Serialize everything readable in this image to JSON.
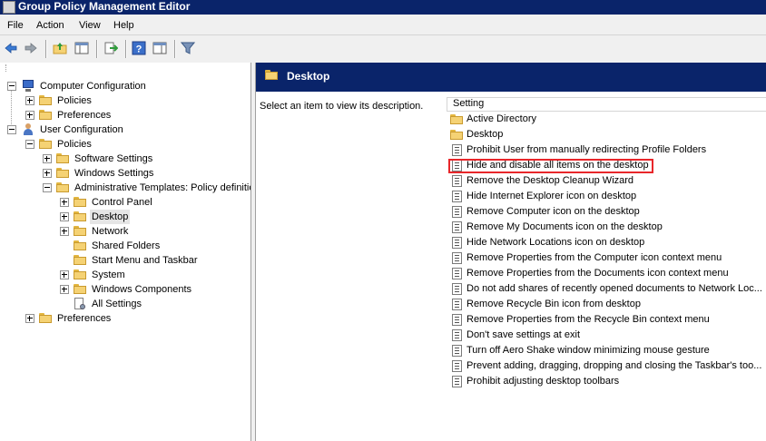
{
  "window": {
    "title": "Group Policy Management Editor"
  },
  "menu": {
    "items": [
      "File",
      "Action",
      "View",
      "Help"
    ]
  },
  "toolbar": {
    "buttons": [
      "back-icon",
      "forward-icon",
      "up-folder-icon",
      "show-hide-console-tree-icon",
      "export-list-icon",
      "help-icon",
      "properties-view-icon",
      "filter-icon"
    ]
  },
  "tree": {
    "items": [
      {
        "label": "Computer Configuration",
        "icon": "computer-icon",
        "expander": "minus"
      },
      {
        "label": "Policies",
        "icon": "folder-icon",
        "expander": "plus"
      },
      {
        "label": "Preferences",
        "icon": "folder-icon",
        "expander": "plus"
      },
      {
        "label": "User Configuration",
        "icon": "user-icon",
        "expander": "minus"
      },
      {
        "label": "Policies",
        "icon": "folder-icon",
        "expander": "minus"
      },
      {
        "label": "Software Settings",
        "icon": "folder-icon",
        "expander": "plus"
      },
      {
        "label": "Windows Settings",
        "icon": "folder-icon",
        "expander": "plus"
      },
      {
        "label": "Administrative Templates: Policy definitio",
        "icon": "folder-icon",
        "expander": "minus"
      },
      {
        "label": "Control Panel",
        "icon": "folder-icon",
        "expander": "plus"
      },
      {
        "label": "Desktop",
        "icon": "folder-icon",
        "expander": "plus",
        "selected": true
      },
      {
        "label": "Network",
        "icon": "folder-icon",
        "expander": "plus"
      },
      {
        "label": "Shared Folders",
        "icon": "folder-icon",
        "expander": "none"
      },
      {
        "label": "Start Menu and Taskbar",
        "icon": "folder-icon",
        "expander": "none"
      },
      {
        "label": "System",
        "icon": "folder-icon",
        "expander": "plus"
      },
      {
        "label": "Windows Components",
        "icon": "folder-icon",
        "expander": "plus"
      },
      {
        "label": "All Settings",
        "icon": "settings-icon",
        "expander": "none"
      },
      {
        "label": "Preferences",
        "icon": "folder-icon",
        "expander": "plus"
      }
    ]
  },
  "details": {
    "header_title": "Desktop",
    "description": "Select an item to view its description.",
    "column_header": "Setting",
    "rows": [
      {
        "label": "Active Directory",
        "icon": "folder-icon"
      },
      {
        "label": "Desktop",
        "icon": "folder-icon"
      },
      {
        "label": "Prohibit User from manually redirecting Profile Folders",
        "icon": "policy-icon"
      },
      {
        "label": "Hide and disable all items on the desktop",
        "icon": "policy-icon",
        "highlighted": true
      },
      {
        "label": "Remove the Desktop Cleanup Wizard",
        "icon": "policy-icon"
      },
      {
        "label": "Hide Internet Explorer icon on desktop",
        "icon": "policy-icon"
      },
      {
        "label": "Remove Computer icon on the desktop",
        "icon": "policy-icon"
      },
      {
        "label": "Remove My Documents icon on the desktop",
        "icon": "policy-icon"
      },
      {
        "label": "Hide Network Locations icon on desktop",
        "icon": "policy-icon"
      },
      {
        "label": "Remove Properties from the Computer icon context menu",
        "icon": "policy-icon"
      },
      {
        "label": "Remove Properties from the Documents icon context menu",
        "icon": "policy-icon"
      },
      {
        "label": "Do not add shares of recently opened documents to Network Loc...",
        "icon": "policy-icon"
      },
      {
        "label": "Remove Recycle Bin icon from desktop",
        "icon": "policy-icon"
      },
      {
        "label": "Remove Properties from the Recycle Bin context menu",
        "icon": "policy-icon"
      },
      {
        "label": "Don't save settings at exit",
        "icon": "policy-icon"
      },
      {
        "label": "Turn off Aero Shake window minimizing mouse gesture",
        "icon": "policy-icon"
      },
      {
        "label": "Prevent adding, dragging, dropping and closing the Taskbar's too...",
        "icon": "policy-icon"
      },
      {
        "label": "Prohibit adjusting desktop toolbars",
        "icon": "policy-icon"
      }
    ]
  },
  "colors": {
    "titlebar": "#0a246a",
    "highlight_box": "#e8262a",
    "folder": "#f5d274"
  }
}
